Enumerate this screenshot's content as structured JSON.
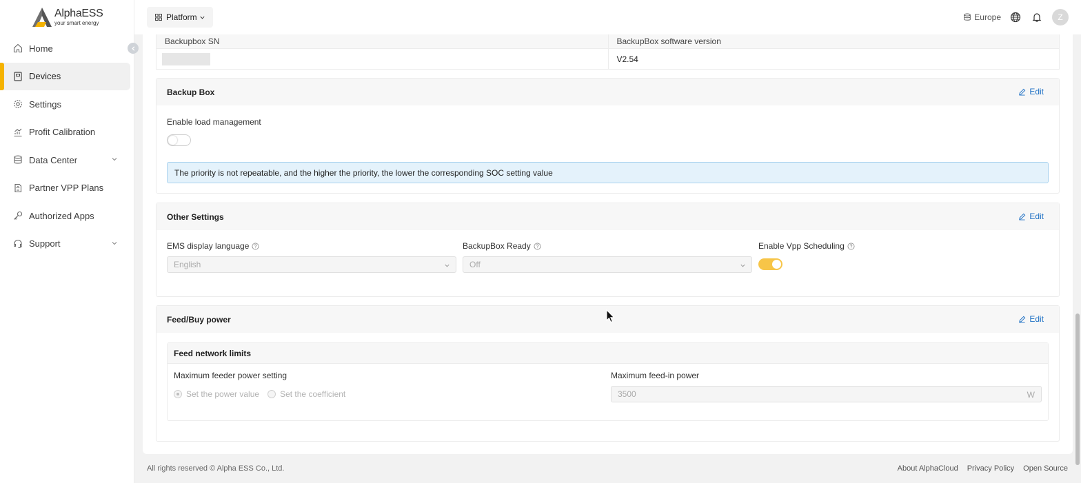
{
  "brand": {
    "name": "AlphaESS",
    "tagline": "your smart energy",
    "accent_color": "#f5b301"
  },
  "sidebar": {
    "items": [
      {
        "label": "Home",
        "icon": "home-icon"
      },
      {
        "label": "Devices",
        "icon": "device-icon",
        "active": true
      },
      {
        "label": "Settings",
        "icon": "gear-icon"
      },
      {
        "label": "Profit Calibration",
        "icon": "chart-icon"
      },
      {
        "label": "Data Center",
        "icon": "database-icon",
        "expandable": true
      },
      {
        "label": "Partner VPP Plans",
        "icon": "document-icon"
      },
      {
        "label": "Authorized Apps",
        "icon": "key-icon"
      },
      {
        "label": "Support",
        "icon": "support-icon",
        "expandable": true
      }
    ]
  },
  "header": {
    "platform_label": "Platform",
    "region_label": "Europe",
    "avatar_letter": "Z"
  },
  "info_table": {
    "col1_header": "Backupbox SN",
    "col2_header": "BackupBox software version",
    "col2_value": "V2.54"
  },
  "backup_box": {
    "title": "Backup Box",
    "edit_label": "Edit",
    "load_mgmt_label": "Enable load management",
    "load_mgmt_enabled": false,
    "notice": "The priority is not repeatable, and the higher the priority, the lower the corresponding SOC setting value"
  },
  "other_settings": {
    "title": "Other Settings",
    "edit_label": "Edit",
    "ems_language_label": "EMS display language",
    "ems_language_value": "English",
    "backupbox_ready_label": "BackupBox Ready",
    "backupbox_ready_value": "Off",
    "vpp_label": "Enable Vpp Scheduling",
    "vpp_enabled": true
  },
  "feed_buy": {
    "title": "Feed/Buy power",
    "edit_label": "Edit",
    "inner_title": "Feed network limits",
    "max_feeder_label": "Maximum feeder power setting",
    "radio_power": "Set the power value",
    "radio_coef": "Set the coefficient",
    "max_feedin_label": "Maximum feed-in power",
    "max_feedin_value": "3500",
    "max_feedin_unit": "W"
  },
  "footer": {
    "copyright": "All rights reserved © Alpha ESS Co., Ltd.",
    "links": [
      "About AlphaCloud",
      "Privacy Policy",
      "Open Source"
    ]
  }
}
